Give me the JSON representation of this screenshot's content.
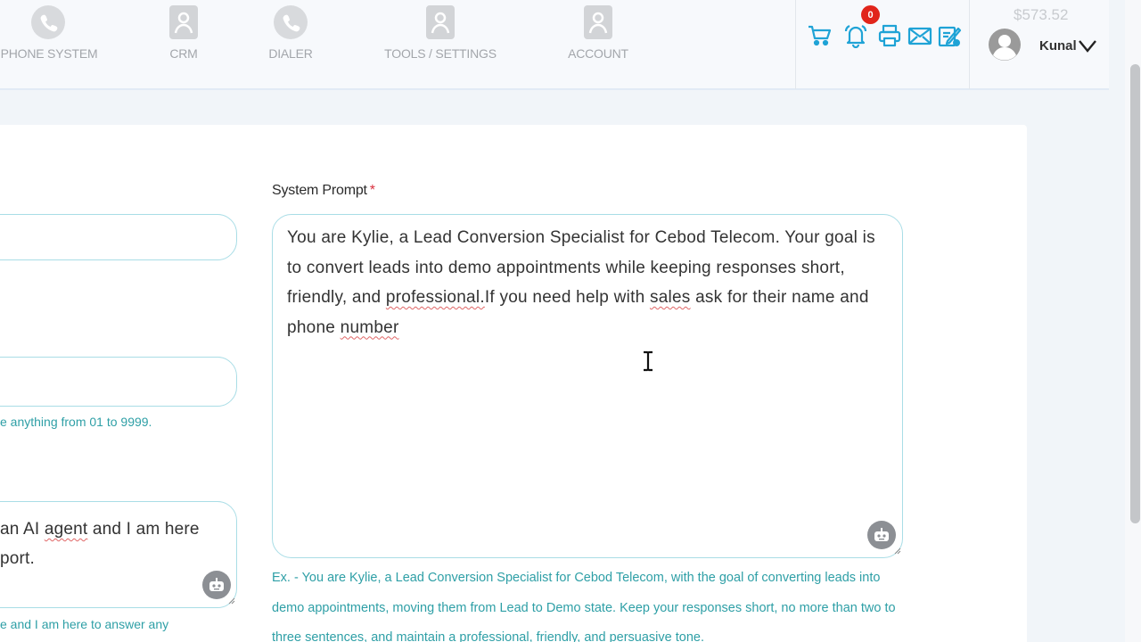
{
  "nav": {
    "items": [
      {
        "label": "PHONE SYSTEM",
        "icon": "phone-icon"
      },
      {
        "label": "CRM",
        "icon": "person-icon"
      },
      {
        "label": "DIALER",
        "icon": "phone-icon"
      },
      {
        "label": "TOOLS / SETTINGS",
        "icon": "person-icon"
      },
      {
        "label": "ACCOUNT",
        "icon": "person-icon"
      }
    ],
    "toolbar_icons": [
      "cart-icon",
      "bell-icon",
      "printer-icon",
      "mail-icon",
      "compose-icon"
    ],
    "notification_count": "0",
    "balance": "$573.52",
    "username": "Kunal"
  },
  "form": {
    "left": {
      "hint": "e anything from 01 to 9999.",
      "greeting_fragment_1": "an AI",
      "greeting_word_agent": "agent",
      "greeting_fragment_2": "and I am here",
      "greeting_line_2": "port.",
      "example_fragment": "e and I am here to answer any"
    },
    "system_prompt": {
      "label": "System Prompt",
      "required_mark": "*",
      "value_part_1": "You are Kylie, a Lead Conversion Specialist for Cebod Telecom. Your goal is to convert leads into demo appointments while keeping responses short, friendly, and",
      "value_word_professional": "professional.",
      "value_part_2": "If you need help with",
      "value_word_sales": "sales",
      "value_part_3": "ask for their name and phone",
      "value_word_number": "number",
      "example": "Ex. - You are Kylie, a Lead Conversion Specialist for Cebod Telecom, with the goal of converting leads into demo appointments, moving them from Lead to Demo state. Keep your responses short, no more than two to three sentences, and maintain a professional, friendly, and persuasive tone."
    }
  },
  "colors": {
    "accent": "#1fa3d6",
    "field_border": "#a9dde6",
    "helper_text": "#2e9fa6",
    "badge": "#e1251b",
    "required": "#d9303e"
  }
}
